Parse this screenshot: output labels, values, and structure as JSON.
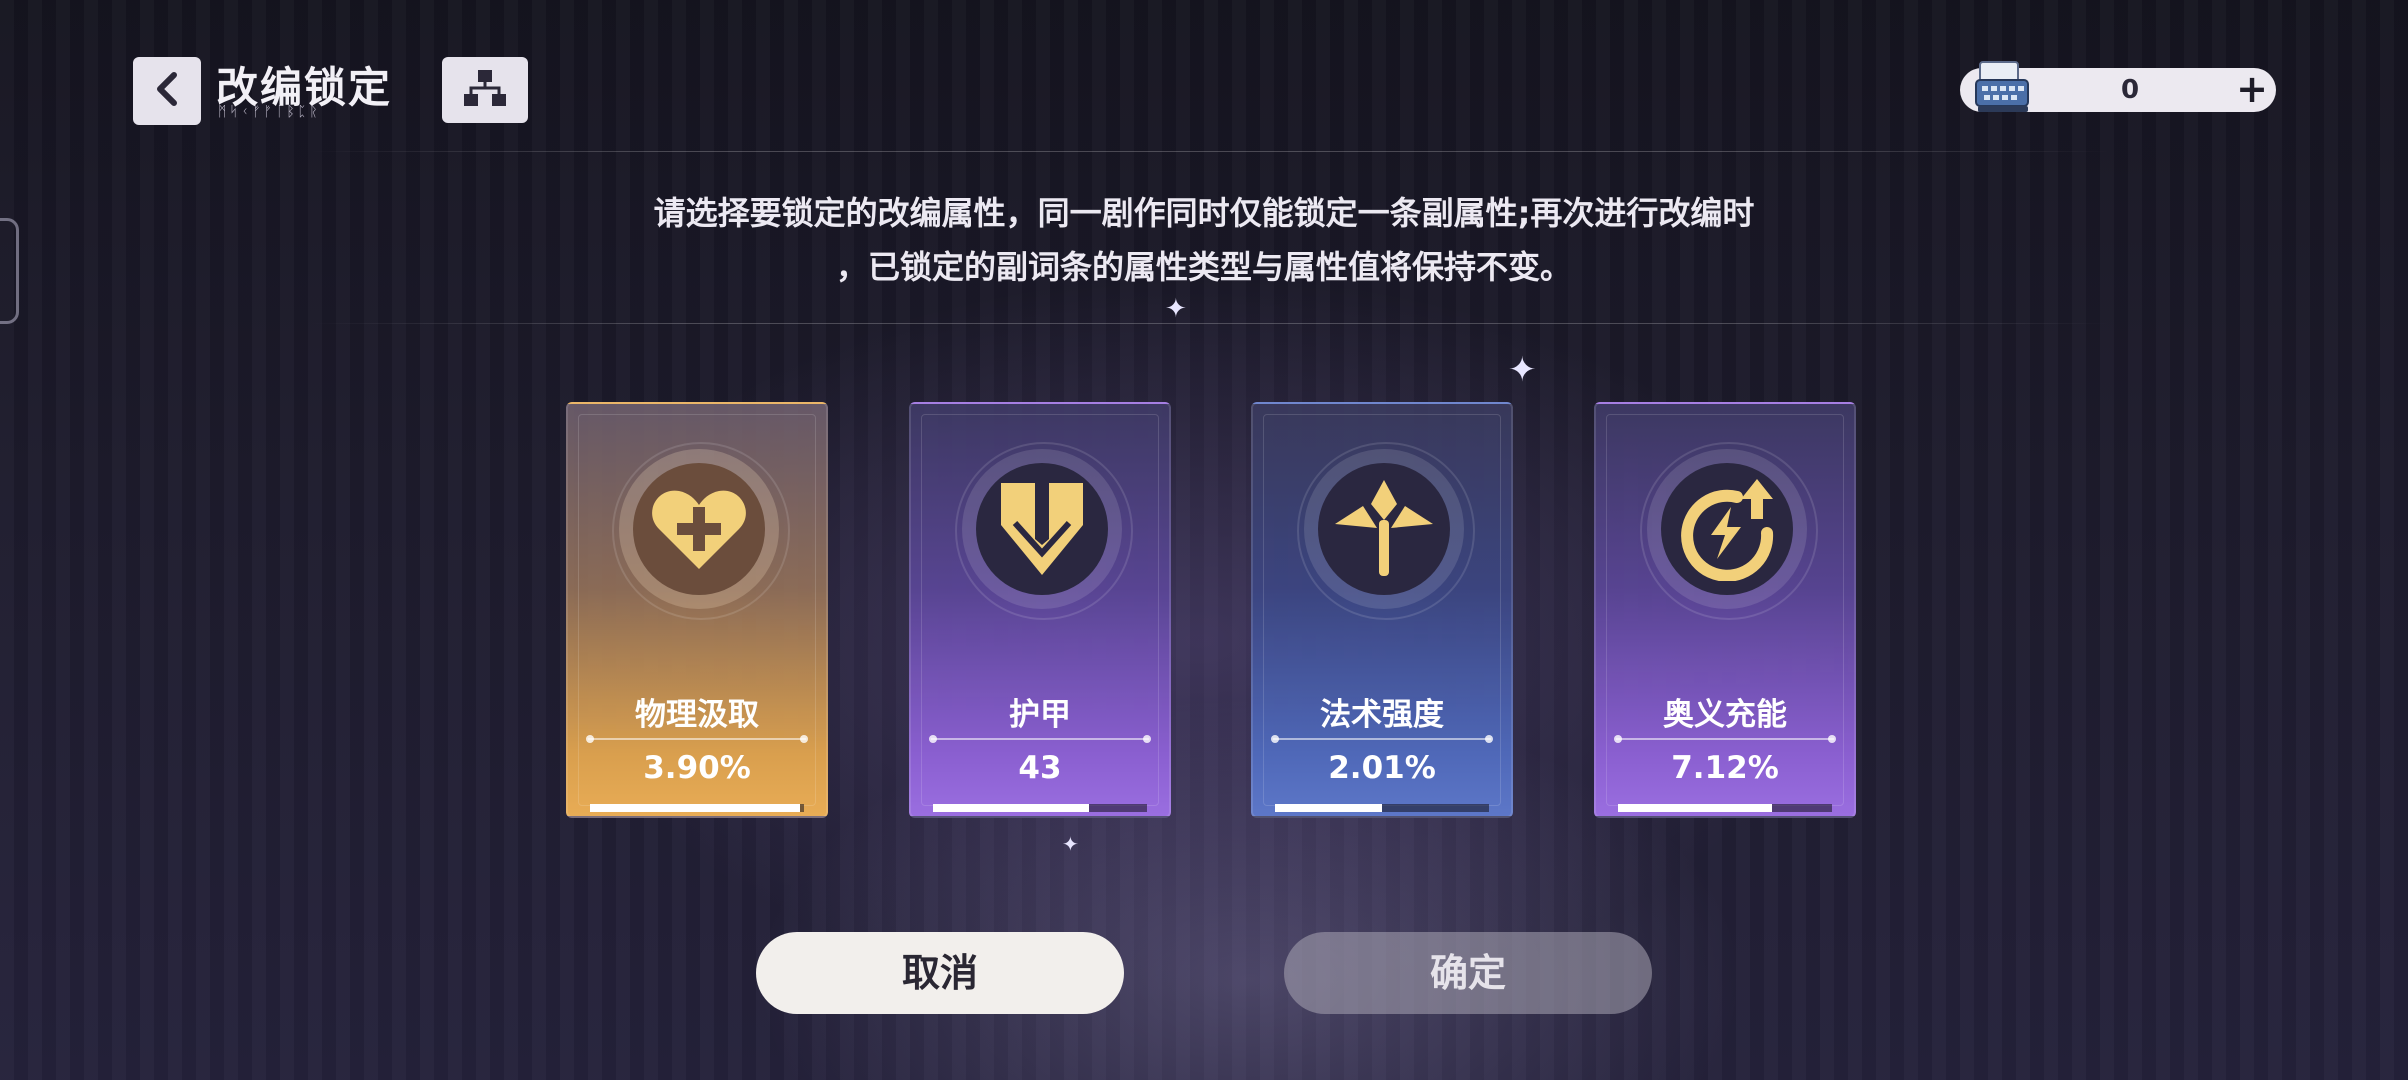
{
  "header": {
    "title": "改编锁定",
    "subtitle": "ᛗᛋᚲᚠᚠᛁᛒᛈᚱ",
    "currency": {
      "value": "0",
      "plus_label": "+"
    }
  },
  "description": {
    "line1": "请选择要锁定的改编属性，同一剧作同时仅能锁定一条副属性;再次进行改编时",
    "line2": "，已锁定的副词条的属性类型与属性值将保持不变。"
  },
  "cards": [
    {
      "name": "物理汲取",
      "value": "3.90%",
      "icon": "heart-cross-icon",
      "style": "gold",
      "progress": 0.98,
      "accent": "#e8ac55"
    },
    {
      "name": "护甲",
      "value": "43",
      "icon": "shield-icon",
      "style": "purple",
      "progress": 0.73,
      "accent": "#9a6ee0"
    },
    {
      "name": "法术强度",
      "value": "2.01%",
      "icon": "staff-icon",
      "style": "blue",
      "progress": 0.5,
      "accent": "#5d77c8"
    },
    {
      "name": "奥义充能",
      "value": "7.12%",
      "icon": "lightning-charge-icon",
      "style": "purple",
      "progress": 0.72,
      "accent": "#9a6ee0"
    }
  ],
  "buttons": {
    "cancel": "取消",
    "confirm": "确定"
  },
  "colors": {
    "icon_gold": "#f2d07a",
    "background": "#1d1b2c"
  }
}
